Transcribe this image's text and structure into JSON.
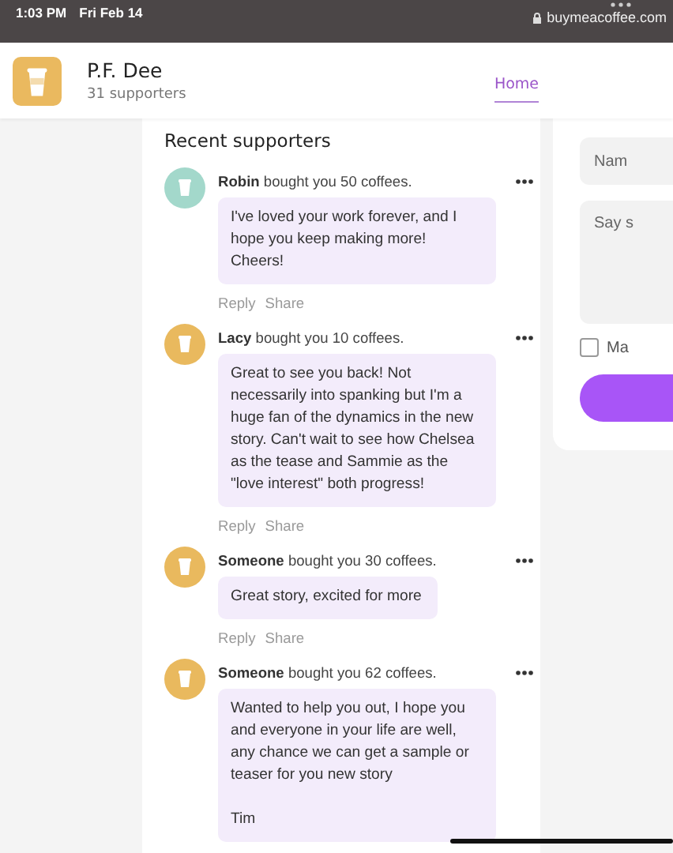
{
  "status_bar": {
    "time": "1:03 PM",
    "date": "Fri Feb 14",
    "url": "buymeacoffee.com"
  },
  "header": {
    "name": "P.F. Dee",
    "supporters": "31 supporters",
    "nav": [
      {
        "label": "Home",
        "selected": true
      }
    ]
  },
  "recent": {
    "title": "Recent supporters",
    "supporters": [
      {
        "name": "Robin",
        "action": "bought you 50 coffees.",
        "color": "#a3d8cb",
        "message": "I've loved your work forever, and I hope you keep making more! Cheers!",
        "actions": [
          "Reply",
          "Share"
        ]
      },
      {
        "name": "Lacy",
        "action": "bought you 10 coffees.",
        "color": "#e9b95e",
        "message": "Great to see you back! Not necessarily into spanking but I'm a huge fan of the dynamics in the new story. Can't wait to see how Chelsea as the tease and Sammie as the \"love interest\" both progress!",
        "actions": [
          "Reply",
          "Share"
        ]
      },
      {
        "name": "Someone",
        "action": "bought you 30 coffees.",
        "color": "#e9b95e",
        "message": "Great story, excited for more",
        "actions": [
          "Reply",
          "Share"
        ]
      },
      {
        "name": "Someone",
        "action": "bought you 62 coffees.",
        "color": "#e9b95e",
        "message": "Wanted to help you out, I hope you and everyone in your life are well, any chance we can get a sample or teaser for you new story\n\nTim"
      }
    ]
  },
  "support_form": {
    "name_placeholder": "Nam",
    "message_placeholder": "Say s",
    "private_label": "Ma",
    "private_checked": false
  }
}
